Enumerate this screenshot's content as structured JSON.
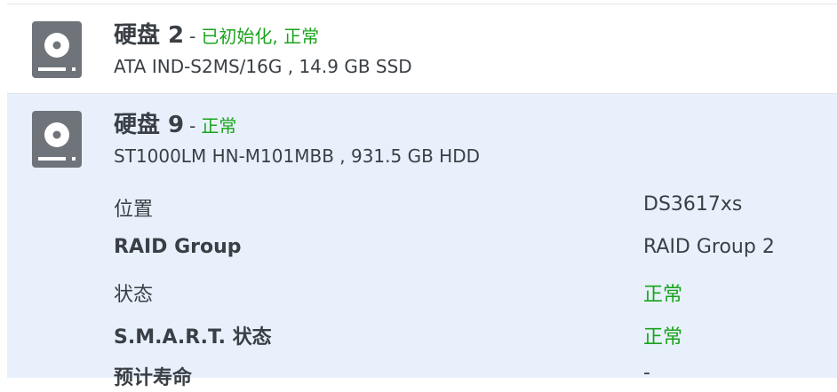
{
  "disks": [
    {
      "name": "硬盘 2",
      "separator": "-",
      "status": "已初始化, 正常",
      "model_line": "ATA IND-S2MS/16G , 14.9 GB SSD",
      "icon": "hard-disk-icon"
    },
    {
      "name": "硬盘 9",
      "separator": "-",
      "status": "正常",
      "model_line": "ST1000LM HN-M101MBB , 931.5 GB HDD",
      "icon": "hard-disk-icon",
      "details": [
        {
          "label": "位置",
          "value": "DS3617xs"
        },
        {
          "label": "RAID Group",
          "value": "RAID Group 2"
        },
        {
          "label": "状态",
          "value": "正常"
        },
        {
          "label": "S.M.A.R.T. 状态",
          "value": "正常"
        },
        {
          "label": "预计寿命",
          "value": "-"
        }
      ]
    }
  ],
  "colors": {
    "status_green": "#19a31b",
    "selected_row_bg": "#e8f1fb",
    "icon_gray": "#6f747b"
  }
}
